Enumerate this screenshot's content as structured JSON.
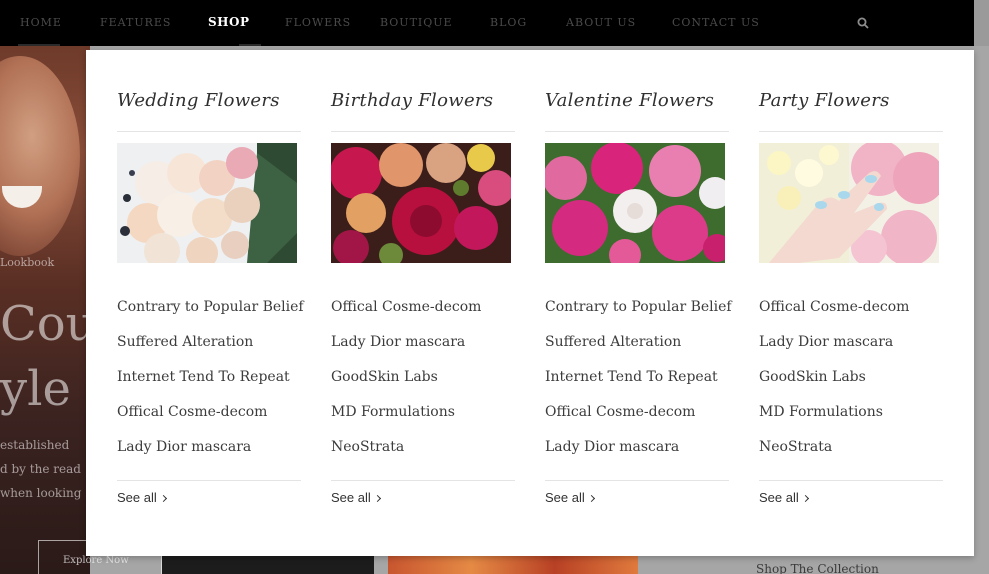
{
  "nav": {
    "items": [
      {
        "label": "Home"
      },
      {
        "label": "Features"
      },
      {
        "label": "Shop"
      },
      {
        "label": "Flowers"
      },
      {
        "label": "Boutique"
      },
      {
        "label": "Blog"
      },
      {
        "label": "About Us"
      },
      {
        "label": "Contact Us"
      }
    ],
    "active": "Shop",
    "search_icon": "search-icon"
  },
  "background": {
    "hero_small": "Lookbook",
    "hero_big1": "Cou",
    "hero_big2": "yle F",
    "hero_line1": "established",
    "hero_line2": "d by the read",
    "hero_line3": "when looking",
    "hero_button": "Explore Now",
    "collection_link": "Shop The Collection"
  },
  "mega_menu": {
    "columns": [
      {
        "title": "Wedding Flowers",
        "image": "wedding-flowers-photo",
        "links": [
          "Contrary to Popular Belief",
          "Suffered Alteration",
          "Internet Tend To Repeat",
          "Offical Cosme-decom",
          "Lady Dior mascara"
        ],
        "see_all": "See all"
      },
      {
        "title": "Birthday Flowers",
        "image": "birthday-flowers-photo",
        "links": [
          "Offical Cosme-decom",
          "Lady Dior mascara",
          "GoodSkin Labs",
          "MD Formulations",
          "NeoStrata"
        ],
        "see_all": "See all"
      },
      {
        "title": "Valentine Flowers",
        "image": "valentine-flowers-photo",
        "links": [
          "Contrary to Popular Belief",
          "Suffered Alteration",
          "Internet Tend To Repeat",
          "Offical Cosme-decom",
          "Lady Dior mascara"
        ],
        "see_all": "See all"
      },
      {
        "title": "Party Flowers",
        "image": "party-flowers-photo",
        "links": [
          "Offical Cosme-decom",
          "Lady Dior mascara",
          "GoodSkin Labs",
          "MD Formulations",
          "NeoStrata"
        ],
        "see_all": "See all"
      }
    ]
  }
}
